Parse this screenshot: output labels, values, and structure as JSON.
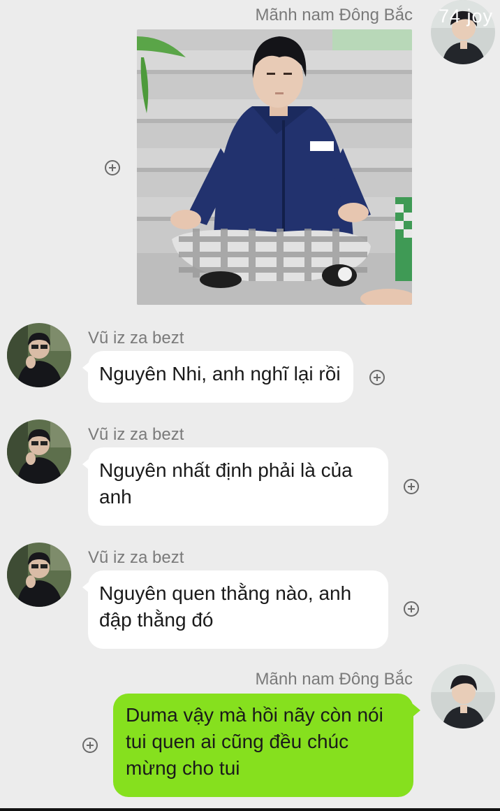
{
  "messages": [
    {
      "sender": "Mãnh nam Đông Bắc",
      "avatar_overlay": "74 joy",
      "type": "image"
    },
    {
      "sender": "Vũ iz za bezt",
      "text": "Nguyên Nhi, anh nghĩ lại rồi"
    },
    {
      "sender": "Vũ iz za bezt",
      "text": "Nguyên nhất định phải là của anh"
    },
    {
      "sender": "Vũ iz za bezt",
      "text": "Nguyên quen thằng nào, anh đập thằng đó"
    },
    {
      "sender": "Mãnh nam Đông Bắc",
      "text": "Duma vậy mà hồi nãy còn nói tui quen ai cũng đều chúc mừng cho tui"
    }
  ],
  "colors": {
    "background": "#ececec",
    "incoming_bubble": "#ffffff",
    "outgoing_bubble": "#86e01e"
  },
  "icons": [
    "add-circle-icon",
    "avatar"
  ]
}
